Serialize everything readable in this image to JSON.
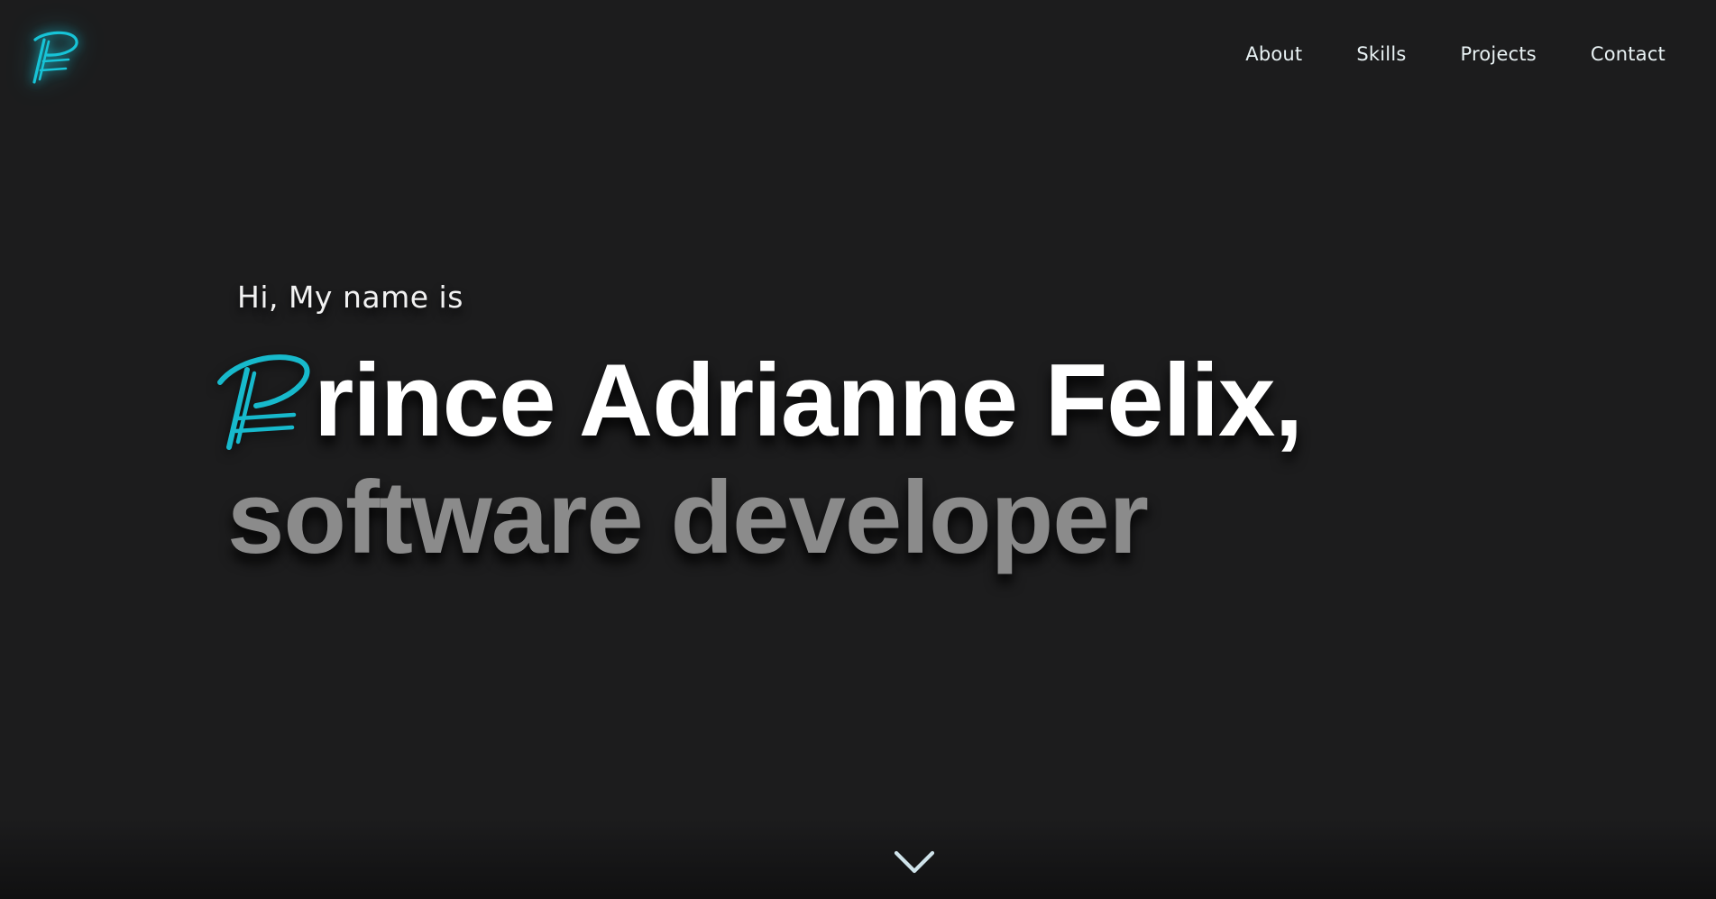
{
  "nav": {
    "items": [
      {
        "label": "About"
      },
      {
        "label": "Skills"
      },
      {
        "label": "Projects"
      },
      {
        "label": "Contact"
      }
    ]
  },
  "hero": {
    "greeting": "Hi, My name is",
    "name_rest": "rince Adrianne Felix,",
    "role": "software developer"
  },
  "colors": {
    "background": "#1c1c1d",
    "accent": "#17b9cc",
    "name": "#ffffff",
    "role": "#8b8b8b"
  },
  "icons": {
    "logo": "pf-monogram-logo-icon",
    "name_initial": "p-monogram-icon",
    "scroll": "chevron-down-icon"
  }
}
